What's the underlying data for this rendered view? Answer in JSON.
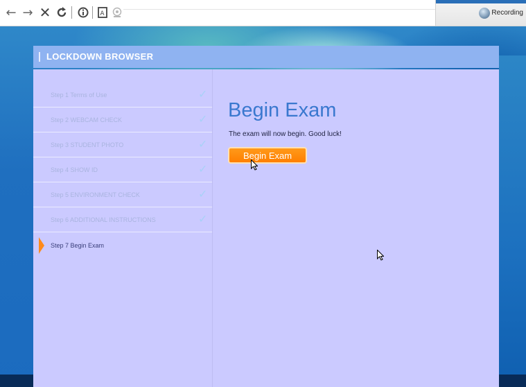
{
  "toolbar": {
    "back_icon": "back-arrow-icon",
    "forward_icon": "forward-arrow-icon",
    "close_icon": "close-icon",
    "reload_icon": "reload-icon",
    "info_icon": "info-icon",
    "reader_icon": "reader-icon",
    "webcam_icon": "webcam-icon",
    "recording_label": "Recording"
  },
  "app": {
    "title": "LOCKDOWN BROWSER",
    "steps": [
      {
        "label": "Step 1   Terms of Use",
        "done": true
      },
      {
        "label": "Step 2   WEBCAM CHECK",
        "done": true
      },
      {
        "label": "Step 3   STUDENT PHOTO",
        "done": true
      },
      {
        "label": "Step 4   SHOW ID",
        "done": true
      },
      {
        "label": "Step 5   ENVIRONMENT CHECK",
        "done": true
      },
      {
        "label": "Step 6   ADDITIONAL INSTRUCTIONS",
        "done": true
      },
      {
        "label": "Step 7   Begin Exam",
        "done": false,
        "active": true
      }
    ],
    "check_glyph": "✓",
    "main": {
      "heading": "Begin Exam",
      "message": "The exam will now begin. Good luck!",
      "button_label": "Begin Exam"
    }
  },
  "colors": {
    "accent_orange": "#ff8a1c",
    "title_blue": "#3a78cf",
    "panel": "#cbcaff"
  }
}
